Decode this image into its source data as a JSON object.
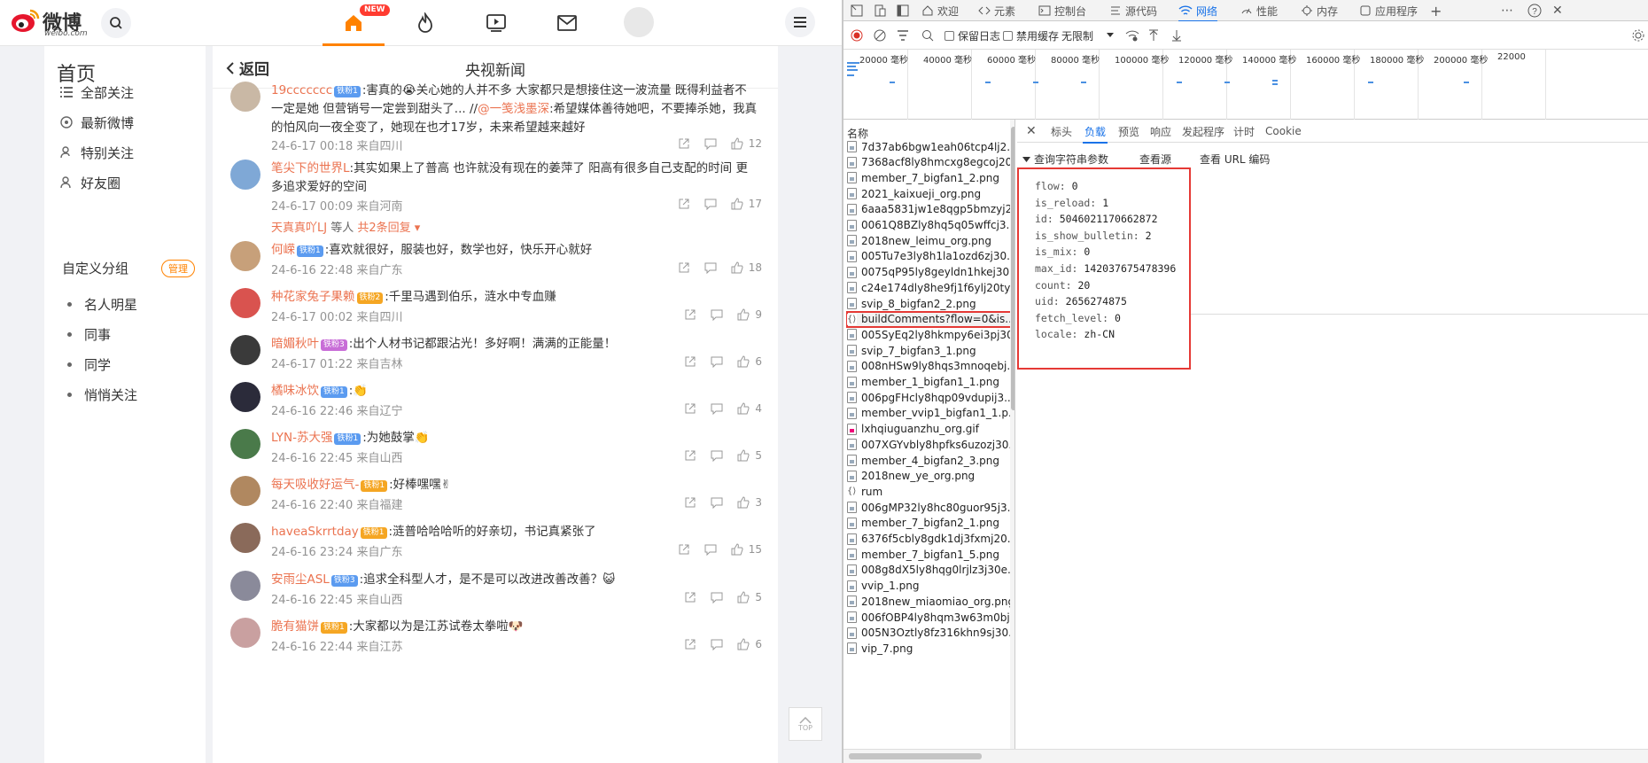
{
  "weibo": {
    "logo_cn": "微博",
    "logo_en": "weibo.com",
    "new_badge": "NEW",
    "sidebar": {
      "title": "首页",
      "items": [
        "全部关注",
        "最新微博",
        "特别关注",
        "好友圈"
      ],
      "group_title": "自定义分组",
      "manage": "管理",
      "groups": [
        "名人明星",
        "同事",
        "同学",
        "悄悄关注"
      ]
    },
    "feed": {
      "back": "返回",
      "title": "央视新闻",
      "comments": [
        {
          "user": "19ccccccc",
          "badge": "铁粉1",
          "badge_color": "#5b9bf0",
          "text": ":害真的😭关心她的人并不多 大家都只是想接住这一波流量 既得利益者不一定是她 但营销号一定尝到甜头了... //",
          "mention": "@一笺浅墨深",
          "text2": ":希望媒体善待她吧，不要捧杀她，我真的怕风向一夜全变了，她现在也才17岁，未来希望越来越好",
          "meta": "24-6-17 00:18 来自四川",
          "likes": "12",
          "avatar": "#c9b8a5"
        },
        {
          "user": "笔尖下的世界L",
          "badge": "",
          "badge_color": "",
          "text": ":其实如果上了普高 也许就没有现在的姜萍了 阳高有很多自己支配的时间 更多追求爱好的空间",
          "mention": "",
          "text2": "",
          "meta": "24-6-17 00:09 来自河南",
          "likes": "17",
          "avatar": "#7fa8d6",
          "reply_user": "天真真吖LJ",
          "reply_mid": "等人",
          "reply_count": "共2条回复"
        },
        {
          "user": "何嵘",
          "badge": "铁粉1",
          "badge_color": "#5b9bf0",
          "text": ":喜欢就很好，服装也好，数学也好，快乐开心就好",
          "mention": "",
          "text2": "",
          "meta": "24-6-16 22:48 来自广东",
          "likes": "18",
          "avatar": "#c7a07a"
        },
        {
          "user": "种花家兔子果赖",
          "badge": "铁粉2",
          "badge_color": "#f5a623",
          "text": ":千里马遇到伯乐，涟水中专血赚",
          "mention": "",
          "text2": "",
          "meta": "24-6-17 00:02 来自四川",
          "likes": "9",
          "avatar": "#d9534f"
        },
        {
          "user": "暗媚秋叶",
          "badge": "铁粉3",
          "badge_color": "#c86dd7",
          "text": ":出个人材书记都跟沾光！多好啊！满满的正能量！",
          "mention": "",
          "text2": "",
          "meta": "24-6-17 01:22 来自吉林",
          "likes": "6",
          "avatar": "#3a3a3a"
        },
        {
          "user": "橘味冰饮",
          "badge": "铁粉1",
          "badge_color": "#5b9bf0",
          "text": ":👏",
          "mention": "",
          "text2": "",
          "meta": "24-6-16 22:46 来自辽宁",
          "likes": "4",
          "avatar": "#2b2b3a"
        },
        {
          "user": "LYN-苏大强",
          "badge": "铁粉1",
          "badge_color": "#5b9bf0",
          "text": ":为她鼓掌👏",
          "mention": "",
          "text2": "",
          "meta": "24-6-16 22:45 来自山西",
          "likes": "5",
          "avatar": "#4a7a4a"
        },
        {
          "user": "每天吸收好运气-",
          "badge": "铁粉1",
          "badge_color": "#f5a623",
          "text": ":好棒嘿嘿✌",
          "mention": "",
          "text2": "",
          "meta": "24-6-16 22:40 来自福建",
          "likes": "3",
          "avatar": "#b08860"
        },
        {
          "user": "haveaSkrrtday",
          "badge": "铁粉1",
          "badge_color": "#f5a623",
          "text": ":涟普哈哈哈听的好亲切，书记真紧张了",
          "mention": "",
          "text2": "",
          "meta": "24-6-16 23:24 来自广东",
          "likes": "15",
          "avatar": "#8a6a5a"
        },
        {
          "user": "安雨尘ASL",
          "badge": "铁粉3",
          "badge_color": "#5b9bf0",
          "text": ":追求全科型人才，是不是可以改进改善改善？😺",
          "mention": "",
          "text2": "",
          "meta": "24-6-16 22:45 来自山西",
          "likes": "5",
          "avatar": "#8a8a9a"
        },
        {
          "user": "脆有猫饼",
          "badge": "铁粉1",
          "badge_color": "#f5a623",
          "text": ":大家都以为是江苏试卷太拳啦🐶",
          "mention": "",
          "text2": "",
          "meta": "24-6-16 22:44 来自江苏",
          "likes": "6",
          "avatar": "#c9a0a0"
        }
      ]
    },
    "top_label": "TOP"
  },
  "devtools": {
    "tabs": [
      "欢迎",
      "元素",
      "控制台",
      "源代码",
      "网络",
      "性能",
      "内存",
      "应用程序"
    ],
    "toolbar": {
      "preserve_log": "保留日志",
      "disable_cache": "禁用缓存",
      "throttle": "无限制"
    },
    "timeline_labels": [
      "20000 毫秒",
      "40000 毫秒",
      "60000 毫秒",
      "80000 毫秒",
      "100000 毫秒",
      "120000 毫秒",
      "140000 毫秒",
      "160000 毫秒",
      "180000 毫秒",
      "200000 毫秒",
      "22000"
    ],
    "names_header": "名称",
    "requests": [
      {
        "name": "7d37ab6bgw1eah06tcp4lj2...",
        "type": "img"
      },
      {
        "name": "7368acf8ly8hmcxg8egcoj20...",
        "type": "img"
      },
      {
        "name": "member_7_bigfan1_2.png",
        "type": "img"
      },
      {
        "name": "2021_kaixueji_org.png",
        "type": "img"
      },
      {
        "name": "6aaa5831jw1e8qgp5bmzyj2...",
        "type": "img"
      },
      {
        "name": "0061Q8BZly8hq5q05wffcj3...",
        "type": "img"
      },
      {
        "name": "2018new_leimu_org.png",
        "type": "img"
      },
      {
        "name": "005Tu7e3ly8h1la1ozd6zj30...",
        "type": "img"
      },
      {
        "name": "0075qP95ly8geyldn1hkej30...",
        "type": "img"
      },
      {
        "name": "c24e174dly8he9fj1f6ylj20ty...",
        "type": "img"
      },
      {
        "name": "svip_8_bigfan2_2.png",
        "type": "img"
      },
      {
        "name": "buildComments?flow=0&is...",
        "type": "xhr"
      },
      {
        "name": "005SyEq2ly8hkmpy6ei3pj30...",
        "type": "img"
      },
      {
        "name": "svip_7_bigfan3_1.png",
        "type": "img"
      },
      {
        "name": "008nHSw9ly8hqs3mnoqebj...",
        "type": "img"
      },
      {
        "name": "member_1_bigfan1_1.png",
        "type": "img"
      },
      {
        "name": "006pgFHcly8hqp09vdupij3...",
        "type": "img"
      },
      {
        "name": "member_vvip1_bigfan1_1.p...",
        "type": "img"
      },
      {
        "name": "lxhqiuguanzhu_org.gif",
        "type": "gif"
      },
      {
        "name": "007XGYvbly8hpfks6uzozj30...",
        "type": "img"
      },
      {
        "name": "member_4_bigfan2_3.png",
        "type": "img"
      },
      {
        "name": "2018new_ye_org.png",
        "type": "img"
      },
      {
        "name": "rum",
        "type": "xhr"
      },
      {
        "name": "006gMP32ly8hc80guor95j3...",
        "type": "img"
      },
      {
        "name": "member_7_bigfan2_1.png",
        "type": "img"
      },
      {
        "name": "6376f5cbly8gdk1dj3fxmj20...",
        "type": "img"
      },
      {
        "name": "member_7_bigfan1_5.png",
        "type": "img"
      },
      {
        "name": "008g8dX5ly8hqg0lrjlz3j30e...",
        "type": "img"
      },
      {
        "name": "vvip_1.png",
        "type": "img"
      },
      {
        "name": "2018new_miaomiao_org.png",
        "type": "img"
      },
      {
        "name": "006fOBP4ly8hqm3w63m0bj...",
        "type": "img"
      },
      {
        "name": "005N3Oztly8fz316khn9sj30...",
        "type": "img"
      },
      {
        "name": "vip_7.png",
        "type": "img"
      }
    ],
    "selected_index": 11,
    "detail_tabs": [
      "标头",
      "负载",
      "预览",
      "响应",
      "发起程序",
      "计时",
      "Cookie"
    ],
    "detail_active": "负载",
    "section_title": "查询字符串参数",
    "view_source": "查看源",
    "view_url_encoded": "查看 URL 编码",
    "params": [
      {
        "k": "flow:",
        "v": "0"
      },
      {
        "k": "is_reload:",
        "v": "1"
      },
      {
        "k": "id:",
        "v": "5046021170662872"
      },
      {
        "k": "is_show_bulletin:",
        "v": "2"
      },
      {
        "k": "is_mix:",
        "v": "0"
      },
      {
        "k": "max_id:",
        "v": "142037675478396"
      },
      {
        "k": "count:",
        "v": "20"
      },
      {
        "k": "uid:",
        "v": "2656274875"
      },
      {
        "k": "fetch_level:",
        "v": "0"
      },
      {
        "k": "locale:",
        "v": "zh-CN"
      }
    ]
  }
}
